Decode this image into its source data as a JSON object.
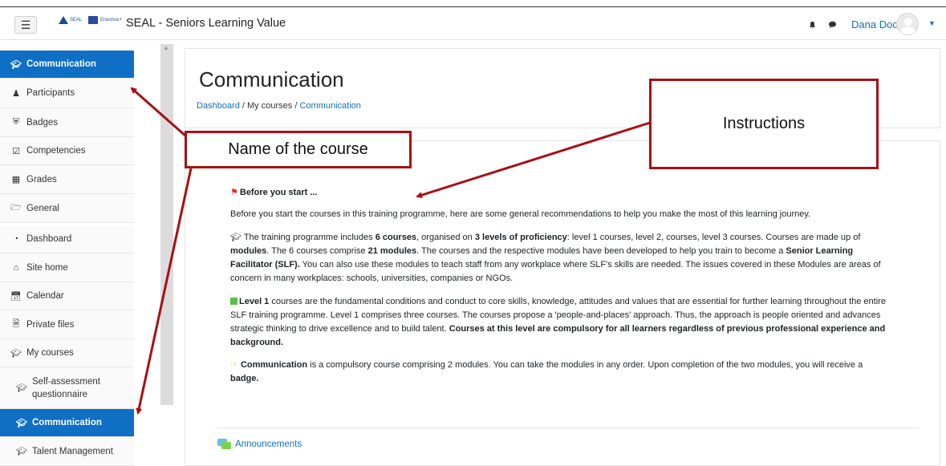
{
  "topbar": {
    "menu_icon": "hamburger-icon",
    "logo_seal_text": "SEAL",
    "logo_erasmus_text": "Erasmus+",
    "site_name": "SEAL - Seniors Learning Value",
    "user_name": "Dana Doca",
    "notification_icon": "bell-icon",
    "messages_icon": "speech-bubble-icon"
  },
  "sidebar": {
    "items": [
      {
        "label": "Communication",
        "icon": "graduation-cap-icon",
        "active": true
      },
      {
        "label": "Participants",
        "icon": "users-icon"
      },
      {
        "label": "Badges",
        "icon": "shield-icon"
      },
      {
        "label": "Competencies",
        "icon": "checkbox-icon"
      },
      {
        "label": "Grades",
        "icon": "table-icon"
      },
      {
        "label": "General",
        "icon": "folder-icon"
      },
      {
        "label": "Dashboard",
        "icon": "dashboard-icon"
      },
      {
        "label": "Site home",
        "icon": "home-icon"
      },
      {
        "label": "Calendar",
        "icon": "calendar-icon"
      },
      {
        "label": "Private files",
        "icon": "file-icon"
      },
      {
        "label": "My courses",
        "icon": "graduation-cap-icon"
      },
      {
        "label": "Self-assessment questionnaire",
        "icon": "graduation-cap-icon"
      },
      {
        "label": "Communication",
        "icon": "graduation-cap-icon",
        "active": true
      },
      {
        "label": "Talent Management",
        "icon": "graduation-cap-icon"
      }
    ]
  },
  "header": {
    "title": "Communication",
    "breadcrumb": {
      "dashboard": "Dashboard",
      "sep1": "/",
      "my_courses": "My courses",
      "sep2": "/",
      "current": "Communication"
    }
  },
  "content": {
    "before_title": "Before you start ...",
    "intro": "Before you start the courses in this training programme, here are some general recommendations to help you make the most of this learning journey.",
    "p1": {
      "a": "The training programme includes ",
      "b": "6 courses",
      "c": ", organised on ",
      "d": "3 levels of proficiency",
      "e": ": level 1 courses, level 2, courses, level 3 courses. Courses are made up of ",
      "f": "modules",
      "g": ". The 6 courses comprise ",
      "h": "21 modules",
      "i": ". The courses and the respective modules have been developed to help you train to become a ",
      "j": "Senior Learning Facilitator (SLF).",
      "k": " You can also use these modules to teach staff from any workplace where SLF's skills are needed. The issues covered in these Modules are areas of concern in many workplaces: schools, universities, companies or NGOs."
    },
    "p2": {
      "a": "Level 1",
      "b": " courses are the fundamental conditions and conduct to core skills, knowledge, attitudes and values that are essential for further learning throughout the entire SLF training programme. Level 1 comprises three courses. The courses propose a 'people-and-places' approach. Thus, the approach is people oriented and advances strategic thinking to drive excellence and to build talent. ",
      "c": "Courses at this level are compulsory for all learners regardless of previous professional experience and background."
    },
    "p3": {
      "a": "Communication",
      "b": " is a compulsory course comprising 2 modules. You can take the modules in any order. Upon completion of the two modules, you will receive a ",
      "c": "badge."
    },
    "announcements": "Announcements"
  },
  "annotations": {
    "name_of_course": "Name of the course",
    "instructions": "Instructions",
    "color": "#a80f13"
  },
  "colors": {
    "accent": "#0f6fc5"
  }
}
